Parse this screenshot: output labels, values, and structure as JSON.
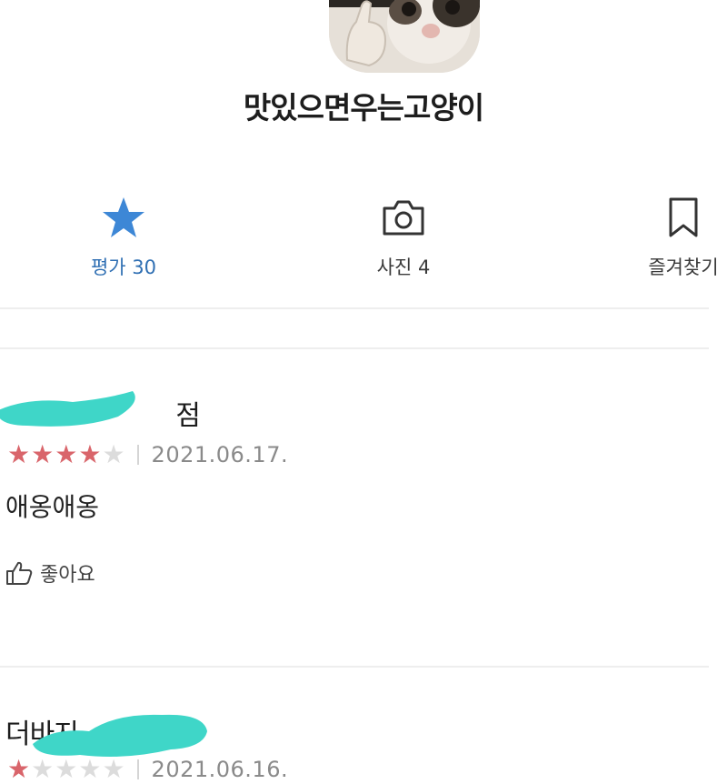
{
  "profile": {
    "username": "맛있으면우는고양이",
    "avatar_icon": "crying-cat-thumbs-up-icon"
  },
  "tabs": [
    {
      "label": "평가 30",
      "icon": "star-icon",
      "active": true
    },
    {
      "label": "사진 4",
      "icon": "camera-icon",
      "active": false
    },
    {
      "label": "즐겨찾기",
      "icon": "bookmark-icon",
      "active": false
    }
  ],
  "reviews": [
    {
      "place_name_suffix": "점",
      "rating": 4,
      "max_rating": 5,
      "date": "2021.06.17.",
      "text": "애옹애옹",
      "like_label": "좋아요"
    },
    {
      "place_name_prefix": "더바지",
      "rating": 1,
      "max_rating": 5,
      "date": "2021.06.16."
    }
  ],
  "colors": {
    "accent_blue": "#2f6fb3",
    "star_filled": "#d9656b",
    "redaction": "#3fd6c8"
  }
}
